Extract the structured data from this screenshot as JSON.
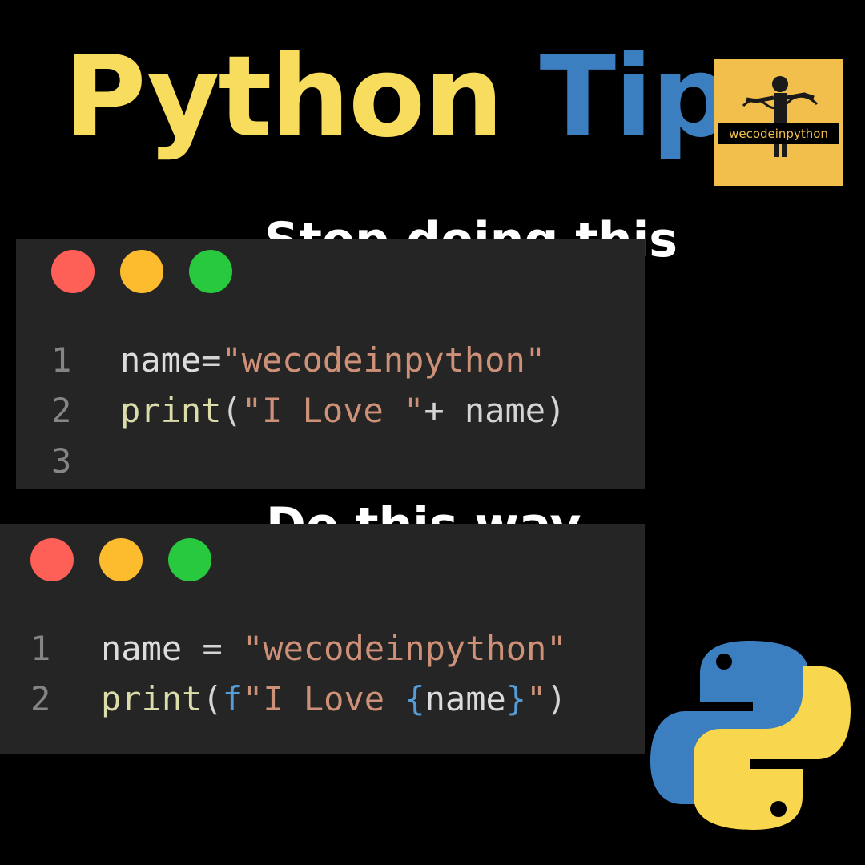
{
  "title": {
    "word1": "Python",
    "word2": "Tip"
  },
  "badge": {
    "text": "wecodeinpython"
  },
  "section1": {
    "heading": "Stop doing this",
    "line_numbers": [
      "1",
      "2",
      "3"
    ],
    "line1": {
      "name": "name",
      "eq": "=",
      "string": "\"wecodeinpython\""
    },
    "line2": {
      "func": "print",
      "open": "(",
      "string": "\"I Love \"",
      "rest": "+ name)"
    }
  },
  "section2": {
    "heading": "Do this way",
    "line_numbers": [
      "1",
      "2"
    ],
    "line1": {
      "name": "name",
      "eq": " = ",
      "string": "\"wecodeinpython\""
    },
    "line2": {
      "func": "print",
      "open": "(",
      "prefix": "f",
      "string_start": "\"I Love ",
      "brace_open": "{",
      "var": "name",
      "brace_close": "}",
      "string_end": "\"",
      "close": ")"
    }
  },
  "colors": {
    "python_yellow": "#f8dc5e",
    "python_blue": "#3c7fc0",
    "badge_bg": "#f2bf4c",
    "panel_bg": "#252526",
    "dot_red": "#fe5f57",
    "dot_yellow": "#fdbc2e",
    "dot_green": "#28c83f"
  },
  "icons": [
    "python-logo-icon",
    "stick-figure-icon"
  ]
}
